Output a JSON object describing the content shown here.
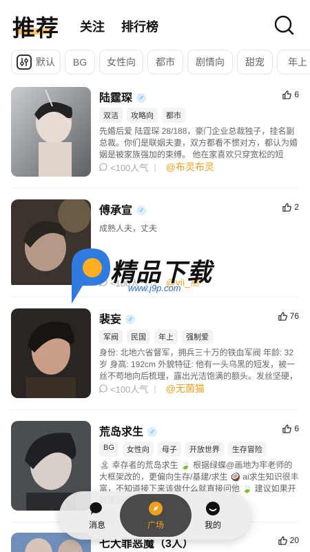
{
  "header": {
    "tabs": [
      "推荐",
      "关注",
      "排行榜"
    ],
    "icons": [
      "search-icon"
    ]
  },
  "filters": {
    "items": [
      "默认",
      "BG",
      "女性向",
      "都市",
      "剧情向",
      "甜宠",
      "年上"
    ]
  },
  "cards": [
    {
      "name": "陆霆琛",
      "likes": "6",
      "tags": [
        "双洁",
        "攻略向",
        "都市"
      ],
      "desc": "先婚后爱 陆霆琛 28/188，豪门企业总裁独子，挂名副总裁。你们是联姻夫妻，双方都看不惯对方，都认为婚姻是被家族强加的束缚。 他在家喜欢只穿宽松的短裤，你总骂他裸…",
      "popularity": "<100人气",
      "author": "@布灵布灵"
    },
    {
      "name": "傅承宣",
      "likes": "2",
      "tags": [],
      "desc": "成熟人夫，丈夫",
      "popularity": "<100人气",
      "author": "@vii_黑"
    },
    {
      "name": "裴妄",
      "likes": "76",
      "tags": [
        "军阀",
        "民国",
        "年上",
        "强制爱"
      ],
      "desc": "身份: 北地六省督军，拥兵三十万的铁血军阀 年龄: 32岁 身高: 192cm 外貌特征: 他有一头乌黑的短发，被一丝不苟地向后梳理，露出光洁饱满的额头。发丝坚硬，如同他本…",
      "popularity": "<100人气",
      "author": "@无菌猫"
    },
    {
      "name": "荒岛求生",
      "likes": "6",
      "tags": [
        "BG",
        "女性向",
        "母子",
        "开放世界",
        "生存冒险"
      ],
      "desc": "🏝 幸存者的荒岛求生 🍃 根据绿蝶@画地为牢老师的大框架改的，更偏向生存/基建/求生 🥥 ai求生知识很丰富，不知道接下来该做什么就直接问他 🍃 建议如果开局遇到野人或…",
      "popularity": "",
      "author": ""
    },
    {
      "name": "七大罪恶魔（3人）",
      "likes": "20",
      "tags": [],
      "desc": "",
      "popularity": "",
      "author": ""
    }
  ],
  "watermark": {
    "text": "精品下载",
    "url": "www.j9p.com"
  },
  "bottom_nav": {
    "items": [
      "消息",
      "广场",
      "我的"
    ],
    "active": "广场",
    "icons": [
      "message-icon",
      "compass-icon",
      "profile-icon"
    ]
  },
  "colors": {
    "accent": "#f0a020",
    "male_badge": "#3a8ef0",
    "nav_active_bg": "#4a4a48"
  }
}
